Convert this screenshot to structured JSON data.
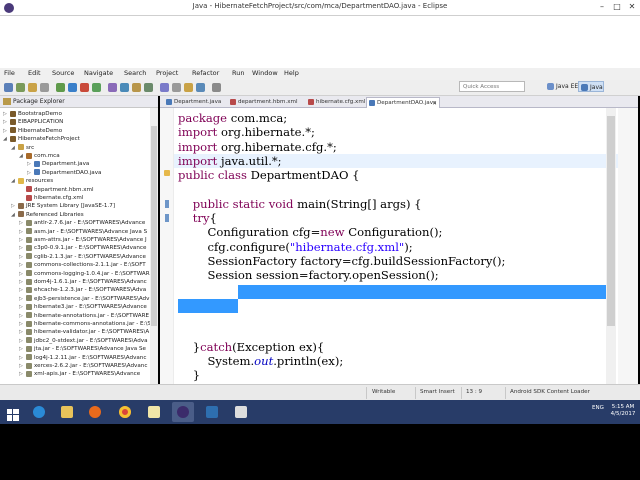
{
  "window": {
    "title": "Java - HibernateFetchProject/src/com/mca/DepartmentDAO.java - Eclipse",
    "minimize": "–",
    "maximize": "□",
    "close": "✕"
  },
  "menu": [
    "File",
    "Edit",
    "Source",
    "Navigate",
    "Search",
    "Project",
    "Refactor",
    "Run",
    "Window",
    "Help"
  ],
  "toolbar": {
    "quick_access_placeholder": "Quick Access",
    "perspective_java_ee": "Java EE",
    "perspective_java": "Java"
  },
  "package_explorer": {
    "title": "Package Explorer",
    "items": [
      {
        "indent": 0,
        "label": "BootstrapDemo",
        "icon": "project-icon",
        "expander": "▷"
      },
      {
        "indent": 0,
        "label": "EIBAPPLICATION",
        "icon": "project-icon",
        "expander": "▷"
      },
      {
        "indent": 0,
        "label": "HibernateDemo",
        "icon": "project-icon",
        "expander": "▷"
      },
      {
        "indent": 0,
        "label": "HibernateFetchProject",
        "icon": "project-icon",
        "expander": "◢"
      },
      {
        "indent": 1,
        "label": "src",
        "icon": "source-folder-icon",
        "expander": "◢"
      },
      {
        "indent": 2,
        "label": "com.mca",
        "icon": "package-icon",
        "expander": "◢"
      },
      {
        "indent": 3,
        "label": "Department.java",
        "icon": "java-file-icon",
        "expander": "▷"
      },
      {
        "indent": 3,
        "label": "DepartmentDAO.java",
        "icon": "java-file-icon",
        "expander": "▷"
      },
      {
        "indent": 1,
        "label": "resources",
        "icon": "folder-icon",
        "expander": "◢"
      },
      {
        "indent": 2,
        "label": "department.hbm.xml",
        "icon": "xml-file-icon",
        "expander": ""
      },
      {
        "indent": 2,
        "label": "hibernate.cfg.xml",
        "icon": "xml-file-icon",
        "expander": ""
      },
      {
        "indent": 1,
        "label": "JRE System Library [JavaSE-1.7]",
        "icon": "library-icon",
        "expander": "▷"
      },
      {
        "indent": 1,
        "label": "Referenced Libraries",
        "icon": "library-icon",
        "expander": "◢"
      },
      {
        "indent": 2,
        "label": "antlr-2.7.6.jar - E:\\SOFTWARES\\Advance",
        "icon": "jar-icon",
        "expander": "▷"
      },
      {
        "indent": 2,
        "label": "asm.jar - E:\\SOFTWARES\\Advance Java S",
        "icon": "jar-icon",
        "expander": "▷"
      },
      {
        "indent": 2,
        "label": "asm-attrs.jar - E:\\SOFTWARES\\Advance J",
        "icon": "jar-icon",
        "expander": "▷"
      },
      {
        "indent": 2,
        "label": "c3p0-0.9.1.jar - E:\\SOFTWARES\\Advance",
        "icon": "jar-icon",
        "expander": "▷"
      },
      {
        "indent": 2,
        "label": "cglib-2.1.3.jar - E:\\SOFTWARES\\Advance",
        "icon": "jar-icon",
        "expander": "▷"
      },
      {
        "indent": 2,
        "label": "commons-collections-2.1.1.jar - E:\\SOFT",
        "icon": "jar-icon",
        "expander": "▷"
      },
      {
        "indent": 2,
        "label": "commons-logging-1.0.4.jar - E:\\SOFTWAR",
        "icon": "jar-icon",
        "expander": "▷"
      },
      {
        "indent": 2,
        "label": "dom4j-1.6.1.jar - E:\\SOFTWARES\\Advanc",
        "icon": "jar-icon",
        "expander": "▷"
      },
      {
        "indent": 2,
        "label": "ehcache-1.2.3.jar - E:\\SOFTWARES\\Adva",
        "icon": "jar-icon",
        "expander": "▷"
      },
      {
        "indent": 2,
        "label": "ejb3-persistence.jar - E:\\SOFTWARES\\Adv",
        "icon": "jar-icon",
        "expander": "▷"
      },
      {
        "indent": 2,
        "label": "hibernate3.jar - E:\\SOFTWARES\\Advance",
        "icon": "jar-icon",
        "expander": "▷"
      },
      {
        "indent": 2,
        "label": "hibernate-annotations.jar - E:\\SOFTWARE",
        "icon": "jar-icon",
        "expander": "▷"
      },
      {
        "indent": 2,
        "label": "hibernate-commons-annotations.jar - E:\\S",
        "icon": "jar-icon",
        "expander": "▷"
      },
      {
        "indent": 2,
        "label": "hibernate-validator.jar - E:\\SOFTWARES\\A",
        "icon": "jar-icon",
        "expander": "▷"
      },
      {
        "indent": 2,
        "label": "jdbc2_0-stdext.jar - E:\\SOFTWARES\\Adva",
        "icon": "jar-icon",
        "expander": "▷"
      },
      {
        "indent": 2,
        "label": "jta.jar - E:\\SOFTWARES\\Advance Java Se",
        "icon": "jar-icon",
        "expander": "▷"
      },
      {
        "indent": 2,
        "label": "log4j-1.2.11.jar - E:\\SOFTWARES\\Advanc",
        "icon": "jar-icon",
        "expander": "▷"
      },
      {
        "indent": 2,
        "label": "xerces-2.6.2.jar - E:\\SOFTWARES\\Advanc",
        "icon": "jar-icon",
        "expander": "▷"
      },
      {
        "indent": 2,
        "label": "xml-apis.jar - E:\\SOFTWARES\\Advance",
        "icon": "jar-icon",
        "expander": "▷"
      }
    ]
  },
  "editor": {
    "tabs": [
      {
        "label": "Department.java",
        "icon": "java-file-icon",
        "active": false
      },
      {
        "label": "department.hbm.xml",
        "icon": "xml-file-icon",
        "active": false
      },
      {
        "label": "hibernate.cfg.xml",
        "icon": "xml-file-icon",
        "active": false
      },
      {
        "label": "DepartmentDAO.java",
        "icon": "java-file-icon",
        "active": true
      }
    ],
    "lines": [
      [
        {
          "t": "kw",
          "v": "package"
        },
        {
          "t": "n",
          "v": " com.mca;"
        }
      ],
      [
        {
          "t": "kw",
          "v": "import"
        },
        {
          "t": "n",
          "v": " org.hibernate.*;"
        }
      ],
      [
        {
          "t": "kw",
          "v": "import"
        },
        {
          "t": "n",
          "v": " org.hibernate.cfg.*;"
        }
      ],
      [
        {
          "t": "kw",
          "v": "import"
        },
        {
          "t": "n",
          "v": " java.util.*;"
        }
      ],
      [
        {
          "t": "kw",
          "v": "public class"
        },
        {
          "t": "n",
          "v": " DepartmentDAO {"
        }
      ],
      [
        {
          "t": "n",
          "v": ""
        }
      ],
      [
        {
          "t": "n",
          "v": "    "
        },
        {
          "t": "kw",
          "v": "public static void"
        },
        {
          "t": "n",
          "v": " main(String[] args) {"
        }
      ],
      [
        {
          "t": "n",
          "v": "    "
        },
        {
          "t": "kw",
          "v": "try"
        },
        {
          "t": "n",
          "v": "{"
        }
      ],
      [
        {
          "t": "n",
          "v": "        Configuration cfg="
        },
        {
          "t": "kw",
          "v": "new"
        },
        {
          "t": "n",
          "v": " Configuration();"
        }
      ],
      [
        {
          "t": "n",
          "v": "        cfg.configure("
        },
        {
          "t": "str",
          "v": "\"hibernate.cfg.xml\""
        },
        {
          "t": "n",
          "v": ");"
        }
      ],
      [
        {
          "t": "n",
          "v": "        SessionFactory factory=cfg.buildSessionFactory();"
        }
      ],
      [
        {
          "t": "n",
          "v": "        Session session=factory.openSession();"
        }
      ],
      [
        {
          "t": "n",
          "v": ""
        }
      ],
      [
        {
          "t": "n",
          "v": ""
        }
      ],
      [
        {
          "t": "n",
          "v": ""
        }
      ],
      [
        {
          "t": "n",
          "v": ""
        }
      ],
      [
        {
          "t": "n",
          "v": "    }"
        },
        {
          "t": "kw",
          "v": "catch"
        },
        {
          "t": "n",
          "v": "(Exception ex){"
        }
      ],
      [
        {
          "t": "n",
          "v": "        System."
        },
        {
          "t": "it",
          "v": "out"
        },
        {
          "t": "n",
          "v": ".println(ex);"
        }
      ],
      [
        {
          "t": "n",
          "v": "    }"
        }
      ],
      [
        {
          "t": "n",
          "v": "    }"
        }
      ]
    ]
  },
  "status_bar": {
    "writable": "Writable",
    "insert_mode": "Smart Insert",
    "position": "13 : 9",
    "task": "Android SDK Content Loader"
  },
  "taskbar": {
    "tray_lang": "ENG",
    "time": "5:15 AM",
    "date": "4/5/2017"
  },
  "colors": {
    "keyword": "#7f0055",
    "string": "#2a00ff",
    "static_field": "#0000c0",
    "selection": "#3399ff",
    "taskbar": "#283c68"
  }
}
